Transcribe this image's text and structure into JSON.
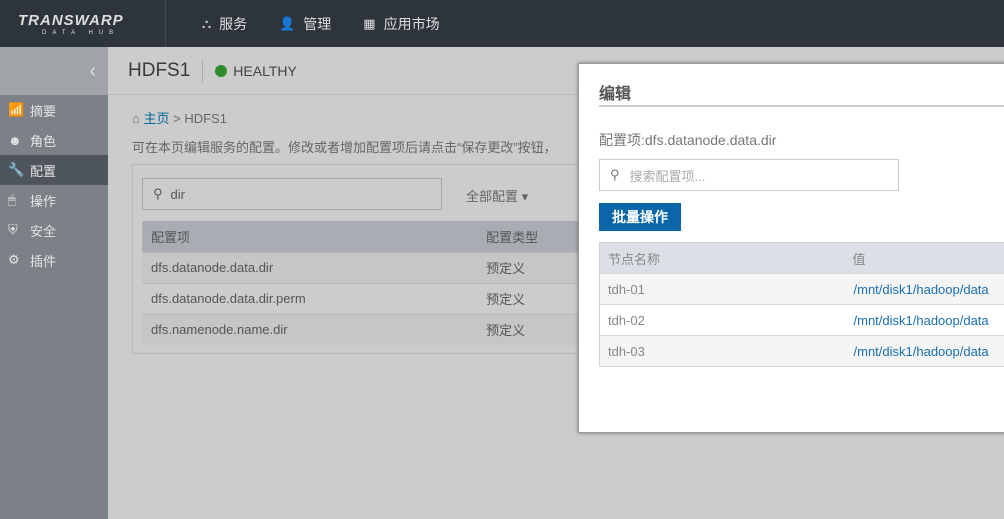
{
  "topbar": {
    "logo_main": "TRANSWARP",
    "logo_sub": "DATA HUB",
    "nav": [
      {
        "icon": "services-icon",
        "glyph": "⛬",
        "label": "服务"
      },
      {
        "icon": "user-icon",
        "glyph": "👤",
        "label": "管理"
      },
      {
        "icon": "app-market-icon",
        "glyph": "▦",
        "label": "应用市场"
      }
    ]
  },
  "sidebar": {
    "collapse_glyph": "‹",
    "items": [
      {
        "icon": "chart-icon",
        "glyph": "📶",
        "label": "摘要"
      },
      {
        "icon": "mask-icon",
        "glyph": "☻",
        "label": "角色"
      },
      {
        "icon": "tools-icon",
        "glyph": "🔧",
        "label": "配置",
        "active": true
      },
      {
        "icon": "mouse-icon",
        "glyph": "🖱",
        "label": "操作"
      },
      {
        "icon": "shield-icon",
        "glyph": "⛨",
        "label": "安全"
      },
      {
        "icon": "gears-icon",
        "glyph": "⚙",
        "label": "插件"
      }
    ]
  },
  "header": {
    "title": "HDFS1",
    "status": "HEALTHY",
    "status_color": "#2e8b2e"
  },
  "breadcrumb": {
    "home": "主页",
    "sep": ">",
    "current": "HDFS1"
  },
  "description": "可在本页编辑服务的配置。修改或者增加配置项后请点击“保存更改”按钮，",
  "config": {
    "search_value": "dir",
    "filter": "全部配置 ▾",
    "columns": [
      "配置项",
      "配置类型"
    ],
    "rows": [
      [
        "dfs.datanode.data.dir",
        "预定义"
      ],
      [
        "dfs.datanode.data.dir.perm",
        "预定义"
      ],
      [
        "dfs.namenode.name.dir",
        "预定义"
      ]
    ]
  },
  "modal": {
    "title": "编辑",
    "config_label": "配置项:dfs.datanode.data.dir",
    "search_placeholder": "搜索配置项...",
    "bulk_button": "批量操作",
    "columns": [
      "节点名称",
      "值"
    ],
    "rows": [
      [
        "tdh-01",
        "/mnt/disk1/hadoop/data"
      ],
      [
        "tdh-02",
        "/mnt/disk1/hadoop/data"
      ],
      [
        "tdh-03",
        "/mnt/disk1/hadoop/data"
      ]
    ],
    "accent": "#0a66a8"
  }
}
